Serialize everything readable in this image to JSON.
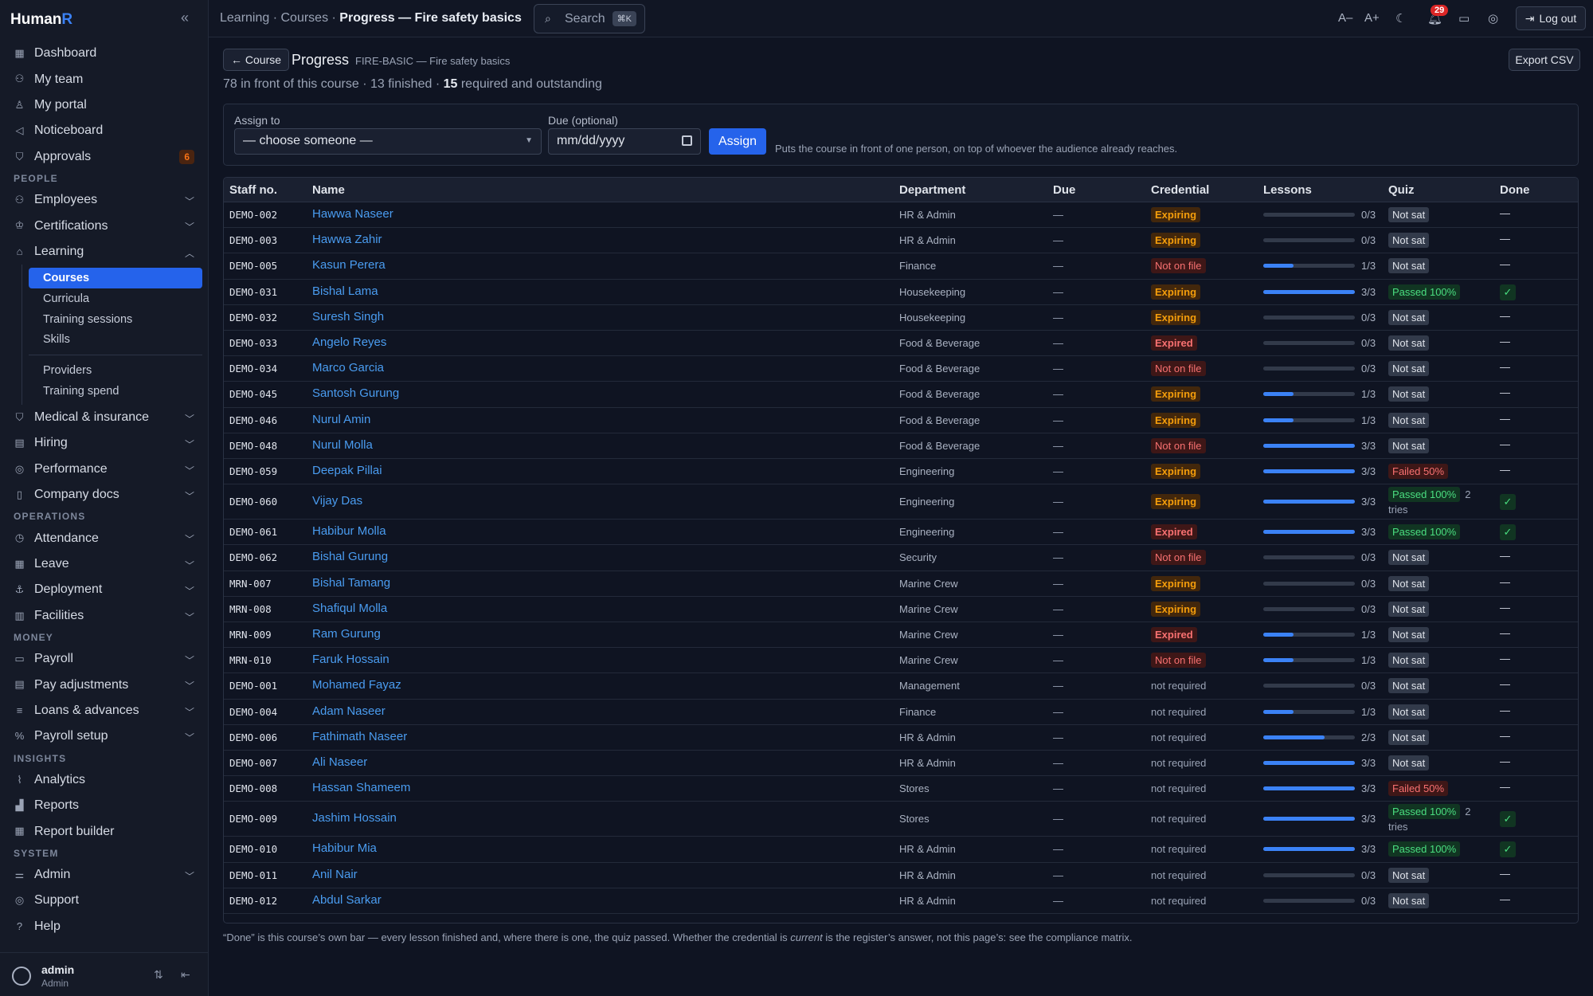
{
  "app": {
    "brand_main": "Human",
    "brand_accent": "R",
    "collapse_icon": "«"
  },
  "sidebar": {
    "top_items": [
      {
        "label": "Dashboard",
        "icon": "grid-icon"
      },
      {
        "label": "My team",
        "icon": "team-icon"
      },
      {
        "label": "My portal",
        "icon": "person-icon"
      },
      {
        "label": "Noticeboard",
        "icon": "megaphone-icon"
      },
      {
        "label": "Approvals",
        "icon": "shield-check-icon",
        "badge": "6"
      }
    ],
    "sections": {
      "people": "PEOPLE",
      "operations": "OPERATIONS",
      "money": "MONEY",
      "insights": "INSIGHTS",
      "system": "SYSTEM"
    },
    "people_items": [
      {
        "label": "Employees",
        "icon": "users-icon"
      },
      {
        "label": "Certifications",
        "icon": "award-icon"
      },
      {
        "label": "Learning",
        "icon": "graduation-cap-icon"
      }
    ],
    "learning_sub": [
      "Courses",
      "Curricula",
      "Training sessions",
      "Skills",
      "Providers",
      "Training spend"
    ],
    "people_items_after": [
      {
        "label": "Medical & insurance",
        "icon": "medical-shield-icon"
      },
      {
        "label": "Hiring",
        "icon": "briefcase-icon"
      },
      {
        "label": "Performance",
        "icon": "target-icon"
      },
      {
        "label": "Company docs",
        "icon": "book-icon"
      }
    ],
    "operations_items": [
      {
        "label": "Attendance",
        "icon": "clock-icon"
      },
      {
        "label": "Leave",
        "icon": "calendar-icon"
      },
      {
        "label": "Deployment",
        "icon": "anchor-icon"
      },
      {
        "label": "Facilities",
        "icon": "building-icon"
      }
    ],
    "money_items": [
      {
        "label": "Payroll",
        "icon": "payroll-icon"
      },
      {
        "label": "Pay adjustments",
        "icon": "receipt-icon"
      },
      {
        "label": "Loans & advances",
        "icon": "coins-icon"
      },
      {
        "label": "Payroll setup",
        "icon": "percent-icon"
      }
    ],
    "insights_items": [
      {
        "label": "Analytics",
        "icon": "trend-icon"
      },
      {
        "label": "Reports",
        "icon": "bar-chart-icon"
      },
      {
        "label": "Report builder",
        "icon": "table-icon"
      }
    ],
    "system_items": [
      {
        "label": "Admin",
        "icon": "sliders-icon",
        "chevron": true
      },
      {
        "label": "Support",
        "icon": "lifebuoy-icon"
      },
      {
        "label": "Help",
        "icon": "help-circle-icon"
      }
    ],
    "user": {
      "name": "admin",
      "role": "Admin"
    }
  },
  "topbar": {
    "breadcrumb": [
      "Learning",
      "Courses"
    ],
    "breadcrumb_current": "Progress — Fire safety basics",
    "search_placeholder": "Search",
    "search_kbd": "⌘K",
    "notifications_count": "29",
    "logout_label": "Log out",
    "font_smaller": "A–",
    "font_larger": "A+"
  },
  "page": {
    "back_label": "← Course",
    "title": "Progress",
    "course_code": "FIRE-BASIC — Fire safety basics",
    "export_label": "Export CSV",
    "summary_pre": "78 in front of this course · 13 finished · ",
    "summary_bold": "15",
    "summary_post": " required and outstanding"
  },
  "assign": {
    "assign_to_label": "Assign to",
    "assign_to_value": "— choose someone —",
    "due_label": "Due (optional)",
    "due_placeholder": "mm/dd/yyyy",
    "button_label": "Assign",
    "hint": "Puts the course in front of one person, on top of whoever the audience already reaches."
  },
  "table": {
    "headers": [
      "Staff no.",
      "Name",
      "Department",
      "Due",
      "Credential",
      "Lessons",
      "Quiz",
      "Done"
    ],
    "rows": [
      {
        "staff": "DEMO-002",
        "name": "Hawwa Naseer",
        "dept": "HR & Admin",
        "due": "—",
        "cred": "Expiring",
        "lessons": 0,
        "count": "0/3",
        "quiz": "Not sat",
        "done": "—"
      },
      {
        "staff": "DEMO-003",
        "name": "Hawwa Zahir",
        "dept": "HR & Admin",
        "due": "—",
        "cred": "Expiring",
        "lessons": 0,
        "count": "0/3",
        "quiz": "Not sat",
        "done": "—"
      },
      {
        "staff": "DEMO-005",
        "name": "Kasun Perera",
        "dept": "Finance",
        "due": "—",
        "cred": "Not on file",
        "lessons": 1,
        "count": "1/3",
        "quiz": "Not sat",
        "done": "—"
      },
      {
        "staff": "DEMO-031",
        "name": "Bishal Lama",
        "dept": "Housekeeping",
        "due": "—",
        "cred": "Expiring",
        "lessons": 3,
        "count": "3/3",
        "quiz": "Passed 100%",
        "done": "✓"
      },
      {
        "staff": "DEMO-032",
        "name": "Suresh Singh",
        "dept": "Housekeeping",
        "due": "—",
        "cred": "Expiring",
        "lessons": 0,
        "count": "0/3",
        "quiz": "Not sat",
        "done": "—"
      },
      {
        "staff": "DEMO-033",
        "name": "Angelo Reyes",
        "dept": "Food & Beverage",
        "due": "—",
        "cred": "Expired",
        "lessons": 0,
        "count": "0/3",
        "quiz": "Not sat",
        "done": "—"
      },
      {
        "staff": "DEMO-034",
        "name": "Marco Garcia",
        "dept": "Food & Beverage",
        "due": "—",
        "cred": "Not on file",
        "lessons": 0,
        "count": "0/3",
        "quiz": "Not sat",
        "done": "—"
      },
      {
        "staff": "DEMO-045",
        "name": "Santosh Gurung",
        "dept": "Food & Beverage",
        "due": "—",
        "cred": "Expiring",
        "lessons": 1,
        "count": "1/3",
        "quiz": "Not sat",
        "done": "—"
      },
      {
        "staff": "DEMO-046",
        "name": "Nurul Amin",
        "dept": "Food & Beverage",
        "due": "—",
        "cred": "Expiring",
        "lessons": 1,
        "count": "1/3",
        "quiz": "Not sat",
        "done": "—"
      },
      {
        "staff": "DEMO-048",
        "name": "Nurul Molla",
        "dept": "Food & Beverage",
        "due": "—",
        "cred": "Not on file",
        "lessons": 3,
        "count": "3/3",
        "quiz": "Not sat",
        "done": "—"
      },
      {
        "staff": "DEMO-059",
        "name": "Deepak Pillai",
        "dept": "Engineering",
        "due": "—",
        "cred": "Expiring",
        "lessons": 3,
        "count": "3/3",
        "quiz": "Failed 50%",
        "done": "—"
      },
      {
        "staff": "DEMO-060",
        "name": "Vijay Das",
        "dept": "Engineering",
        "due": "—",
        "cred": "Expiring",
        "lessons": 3,
        "count": "3/3",
        "quiz": "Passed 100%",
        "tries": "2 tries",
        "done": "✓"
      },
      {
        "staff": "DEMO-061",
        "name": "Habibur Molla",
        "dept": "Engineering",
        "due": "—",
        "cred": "Expired",
        "lessons": 3,
        "count": "3/3",
        "quiz": "Passed 100%",
        "done": "✓"
      },
      {
        "staff": "DEMO-062",
        "name": "Bishal Gurung",
        "dept": "Security",
        "due": "—",
        "cred": "Not on file",
        "lessons": 0,
        "count": "0/3",
        "quiz": "Not sat",
        "done": "—"
      },
      {
        "staff": "MRN-007",
        "name": "Bishal Tamang",
        "dept": "Marine Crew",
        "due": "—",
        "cred": "Expiring",
        "lessons": 0,
        "count": "0/3",
        "quiz": "Not sat",
        "done": "—"
      },
      {
        "staff": "MRN-008",
        "name": "Shafiqul Molla",
        "dept": "Marine Crew",
        "due": "—",
        "cred": "Expiring",
        "lessons": 0,
        "count": "0/3",
        "quiz": "Not sat",
        "done": "—"
      },
      {
        "staff": "MRN-009",
        "name": "Ram Gurung",
        "dept": "Marine Crew",
        "due": "—",
        "cred": "Expired",
        "lessons": 1,
        "count": "1/3",
        "quiz": "Not sat",
        "done": "—"
      },
      {
        "staff": "MRN-010",
        "name": "Faruk Hossain",
        "dept": "Marine Crew",
        "due": "—",
        "cred": "Not on file",
        "lessons": 1,
        "count": "1/3",
        "quiz": "Not sat",
        "done": "—"
      },
      {
        "staff": "DEMO-001",
        "name": "Mohamed Fayaz",
        "dept": "Management",
        "due": "—",
        "cred": "not required",
        "lessons": 0,
        "count": "0/3",
        "quiz": "Not sat",
        "done": "—"
      },
      {
        "staff": "DEMO-004",
        "name": "Adam Naseer",
        "dept": "Finance",
        "due": "—",
        "cred": "not required",
        "lessons": 1,
        "count": "1/3",
        "quiz": "Not sat",
        "done": "—"
      },
      {
        "staff": "DEMO-006",
        "name": "Fathimath Naseer",
        "dept": "HR & Admin",
        "due": "—",
        "cred": "not required",
        "lessons": 2,
        "count": "2/3",
        "quiz": "Not sat",
        "done": "—"
      },
      {
        "staff": "DEMO-007",
        "name": "Ali Naseer",
        "dept": "HR & Admin",
        "due": "—",
        "cred": "not required",
        "lessons": 3,
        "count": "3/3",
        "quiz": "Not sat",
        "done": "—"
      },
      {
        "staff": "DEMO-008",
        "name": "Hassan Shameem",
        "dept": "Stores",
        "due": "—",
        "cred": "not required",
        "lessons": 3,
        "count": "3/3",
        "quiz": "Failed 50%",
        "done": "—"
      },
      {
        "staff": "DEMO-009",
        "name": "Jashim Hossain",
        "dept": "Stores",
        "due": "—",
        "cred": "not required",
        "lessons": 3,
        "count": "3/3",
        "quiz": "Passed 100%",
        "tries": "2 tries",
        "done": "✓"
      },
      {
        "staff": "DEMO-010",
        "name": "Habibur Mia",
        "dept": "HR & Admin",
        "due": "—",
        "cred": "not required",
        "lessons": 3,
        "count": "3/3",
        "quiz": "Passed 100%",
        "done": "✓"
      },
      {
        "staff": "DEMO-011",
        "name": "Anil Nair",
        "dept": "HR & Admin",
        "due": "—",
        "cred": "not required",
        "lessons": 0,
        "count": "0/3",
        "quiz": "Not sat",
        "done": "—"
      },
      {
        "staff": "DEMO-012",
        "name": "Abdul Sarkar",
        "dept": "HR & Admin",
        "due": "—",
        "cred": "not required",
        "lessons": 0,
        "count": "0/3",
        "quiz": "Not sat",
        "done": "—"
      }
    ],
    "lessons_total": 3
  },
  "footnote": {
    "pre": "“Done” is this course’s own bar — every lesson finished and, where there is one, the quiz passed. Whether the credential is ",
    "em": "current",
    "post": " is the register’s answer, not this page’s: see the compliance matrix."
  },
  "colors": {
    "accent": "#2563eb",
    "link": "#4a9cf0",
    "bg": "#0f1422",
    "sidebar": "#151a27"
  }
}
